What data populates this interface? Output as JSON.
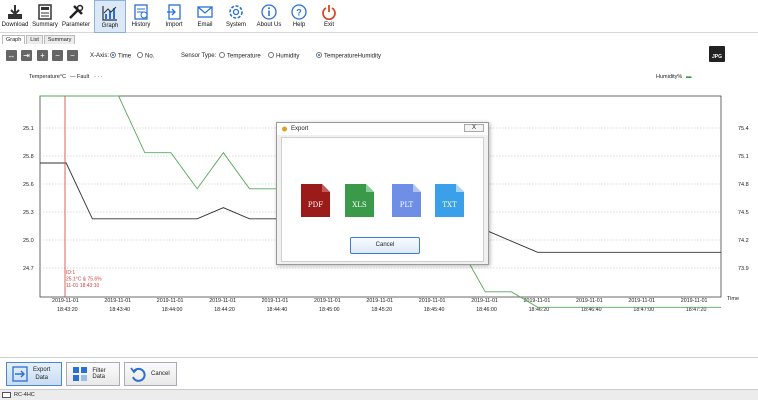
{
  "toolbar": {
    "items": [
      {
        "label": "Download",
        "icon": "download-icon"
      },
      {
        "label": "Summary",
        "icon": "summary-icon"
      },
      {
        "label": "Parameter",
        "icon": "parameter-icon"
      },
      {
        "label": "Graph",
        "icon": "graph-icon"
      },
      {
        "label": "History",
        "icon": "history-icon"
      },
      {
        "label": "Import",
        "icon": "import-icon"
      },
      {
        "label": "Email",
        "icon": "email-icon"
      },
      {
        "label": "System",
        "icon": "system-icon"
      },
      {
        "label": "About Us",
        "icon": "info-icon"
      },
      {
        "label": "Help",
        "icon": "help-icon"
      },
      {
        "label": "Exit",
        "icon": "power-icon"
      }
    ]
  },
  "tabs": [
    {
      "label": "Graph",
      "active": true
    },
    {
      "label": "List",
      "active": false
    },
    {
      "label": "Summary",
      "active": false
    }
  ],
  "options": {
    "xaxis_label": "X-Axis:",
    "xaxis_time": "Time",
    "xaxis_no": "No.",
    "sensor_label": "Sensor Type:",
    "sensor_temperature": "Temperature",
    "sensor_humidity": "Humidity",
    "sensor_both": "TemperatureHumidity",
    "jpg_label": "JPG"
  },
  "legend": {
    "left_axis": "Temperature°C",
    "fault": "Fault",
    "right_axis": "Humidity%"
  },
  "chart_data": {
    "type": "line",
    "xlabel": "Time",
    "x": [
      "2019-11-01 18:43:20",
      "2019-11-01 18:43:40",
      "2019-11-01 18:44:00",
      "2019-11-01 18:44:20",
      "2019-11-01 18:44:40",
      "2019-11-01 18:45:00",
      "2019-11-01 18:45:20",
      "2019-11-01 18:45:40",
      "2019-11-01 18:46:00",
      "2019-11-01 18:46:20",
      "2019-11-01 18:46:40",
      "2019-11-01 18:47:00",
      "2019-11-01 18:47:20"
    ],
    "x_tick_labels": [
      {
        "date": "2019-11-01",
        "time": "18:43:20"
      },
      {
        "date": "2019-11-01",
        "time": "18:43:40"
      },
      {
        "date": "2019-11-01",
        "time": "18:44:00"
      },
      {
        "date": "2019-11-01",
        "time": "18:44:20"
      },
      {
        "date": "2019-11-01",
        "time": "18:44:40"
      },
      {
        "date": "2019-11-01",
        "time": "18:45:00"
      },
      {
        "date": "2019-11-01",
        "time": "18:45:20"
      },
      {
        "date": "2019-11-01",
        "time": "18:45:40"
      },
      {
        "date": "2019-11-01",
        "time": "18:46:00"
      },
      {
        "date": "2019-11-01",
        "time": "18:46:20"
      },
      {
        "date": "2019-11-01",
        "time": "18:46:40"
      },
      {
        "date": "2019-11-01",
        "time": "18:47:00"
      },
      {
        "date": "2019-11-01",
        "time": "18:47:20"
      }
    ],
    "y_left_ticks": [
      "25.1",
      "25.8",
      "25.6",
      "25.3",
      "25.0",
      "24.7"
    ],
    "y_right_ticks": [
      "75.4",
      "75.1",
      "74.8",
      "74.5",
      "74.2",
      "73.9"
    ],
    "y_left_range": [
      24.5,
      25.4
    ],
    "y_right_range": [
      73.7,
      75.65
    ],
    "grid": true,
    "series": [
      {
        "axis": "left",
        "color": "#333333",
        "points": [
          [
            "18:43:20",
            25.1
          ],
          [
            "18:43:30",
            25.1
          ],
          [
            "18:43:40",
            24.85
          ],
          [
            "18:44:20",
            24.85
          ],
          [
            "18:44:30",
            24.9
          ],
          [
            "18:44:40",
            24.85
          ],
          [
            "18:46:00",
            24.85
          ],
          [
            "18:46:20",
            24.75
          ],
          [
            "18:46:30",
            24.7
          ],
          [
            "18:47:40",
            24.7
          ]
        ]
      },
      {
        "axis": "right",
        "color": "#5aa85a",
        "points": [
          [
            "18:43:20",
            75.65
          ],
          [
            "18:43:50",
            75.65
          ],
          [
            "18:44:00",
            75.1
          ],
          [
            "18:44:10",
            75.1
          ],
          [
            "18:44:20",
            74.75
          ],
          [
            "18:44:30",
            75.1
          ],
          [
            "18:44:40",
            74.75
          ],
          [
            "18:45:00",
            74.75
          ],
          [
            "18:46:00",
            74.2
          ],
          [
            "18:46:10",
            73.75
          ],
          [
            "18:46:20",
            73.75
          ],
          [
            "18:46:30",
            73.6
          ],
          [
            "18:47:40",
            73.6
          ]
        ]
      }
    ],
    "marker": {
      "x": "18:43:20",
      "color": "#c8413b",
      "lines": [
        "ID:1",
        "25.1°C & 75.6%",
        "11-01 18:43:10"
      ]
    }
  },
  "dialog": {
    "title": "Export",
    "close": "X",
    "formats": [
      {
        "label": "PDF",
        "color": "#9b1b1b",
        "icon": "pdf-file-icon"
      },
      {
        "label": "XLS",
        "color": "#3b9a4a",
        "icon": "xls-file-icon"
      },
      {
        "label": "PLT",
        "color": "#6f8fe6",
        "icon": "plt-file-icon"
      },
      {
        "label": "TXT",
        "color": "#3aa0ea",
        "icon": "txt-file-icon"
      }
    ],
    "cancel": "Cancel"
  },
  "bottom": {
    "export_line1": "Export",
    "export_line2": "Data",
    "filter": "Filter Data",
    "cancel": "Cancel"
  },
  "status": {
    "text": "RC-4HC"
  }
}
